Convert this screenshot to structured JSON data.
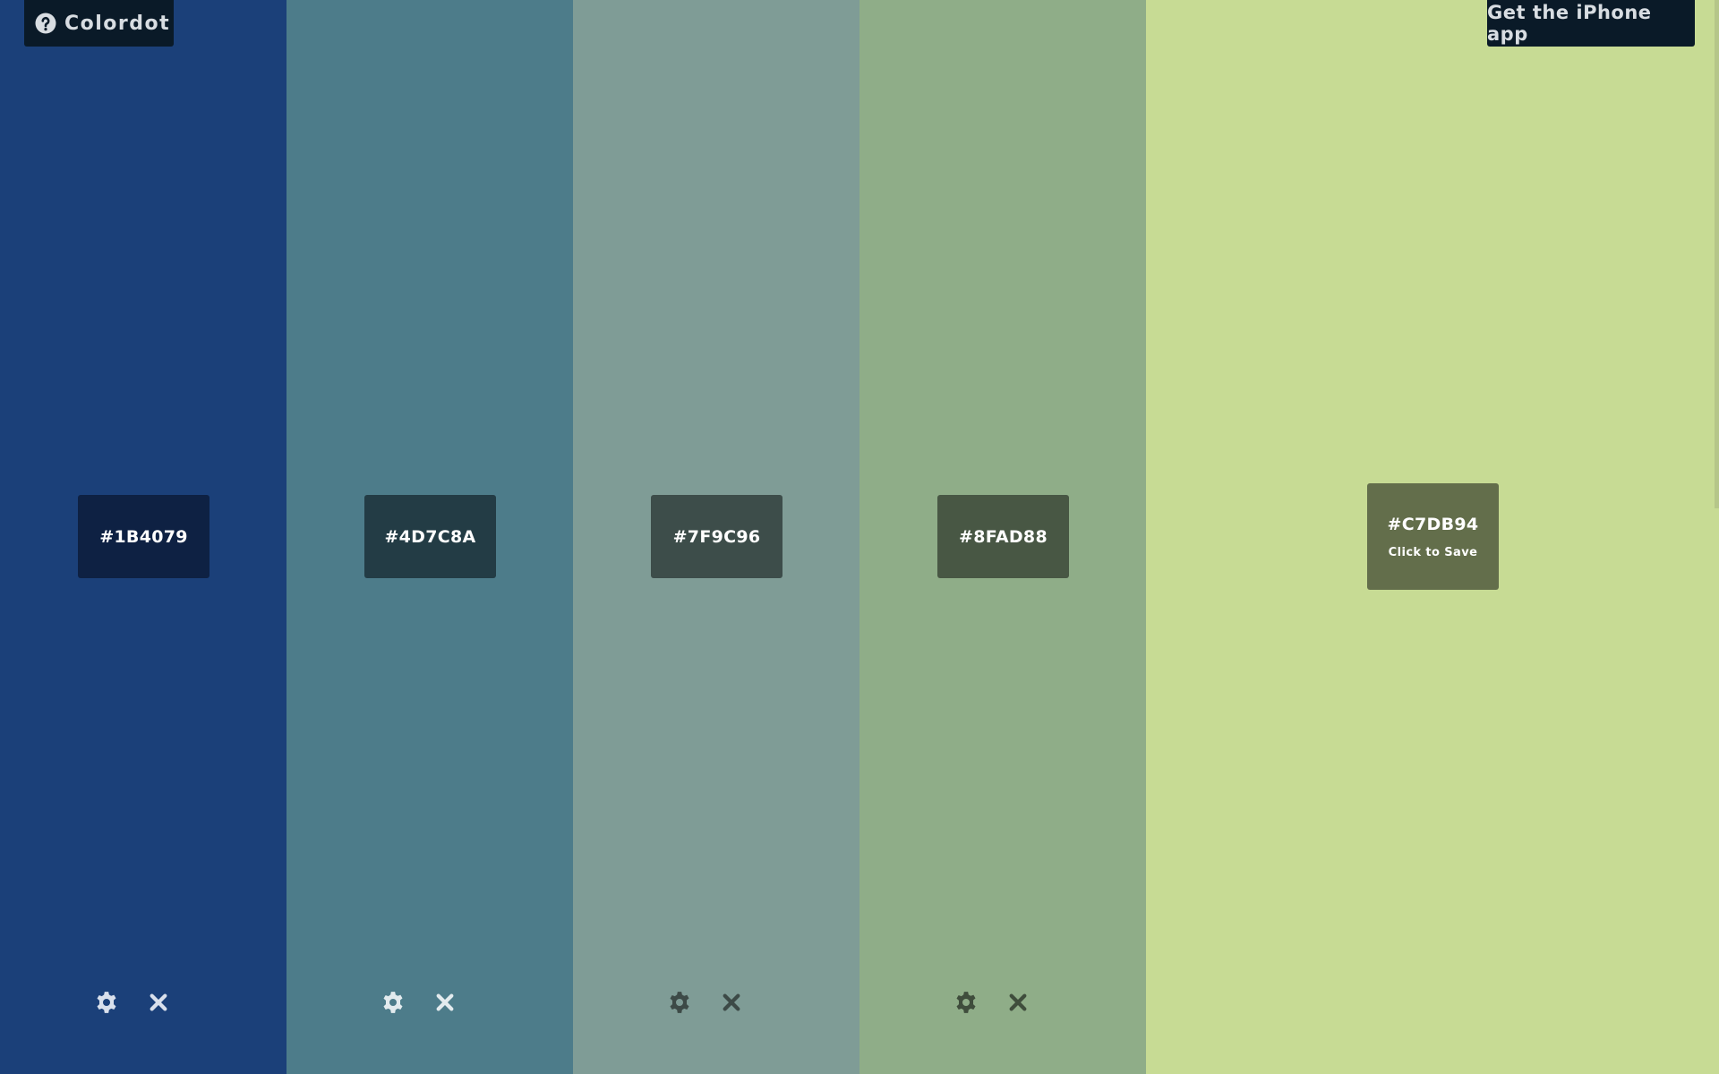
{
  "app": {
    "brand_label": "Colordot",
    "cta_label": "Get the iPhone app"
  },
  "columns": [
    {
      "color": "#1B4079",
      "hex_label": "#1B4079",
      "swatch_bg": "#0E2143",
      "icon_color": "#d9e0ec"
    },
    {
      "color": "#4D7C8A",
      "hex_label": "#4D7C8A",
      "swatch_bg": "#233C45",
      "icon_color": "#e3ebee"
    },
    {
      "color": "#7F9C96",
      "hex_label": "#7F9C96",
      "swatch_bg": "#3D4D4A",
      "icon_color": "#3d4a47"
    },
    {
      "color": "#8FAD88",
      "hex_label": "#8FAD88",
      "swatch_bg": "#485744",
      "icon_color": "#3f4d3c"
    },
    {
      "color": "#C7DB94",
      "hex_label": "#C7DB94",
      "swatch_bg": "#636E4B",
      "hint": "Click to Save"
    }
  ],
  "icons": {
    "help": "question-circle-icon",
    "gear": "gear-icon",
    "close": "close-icon"
  }
}
